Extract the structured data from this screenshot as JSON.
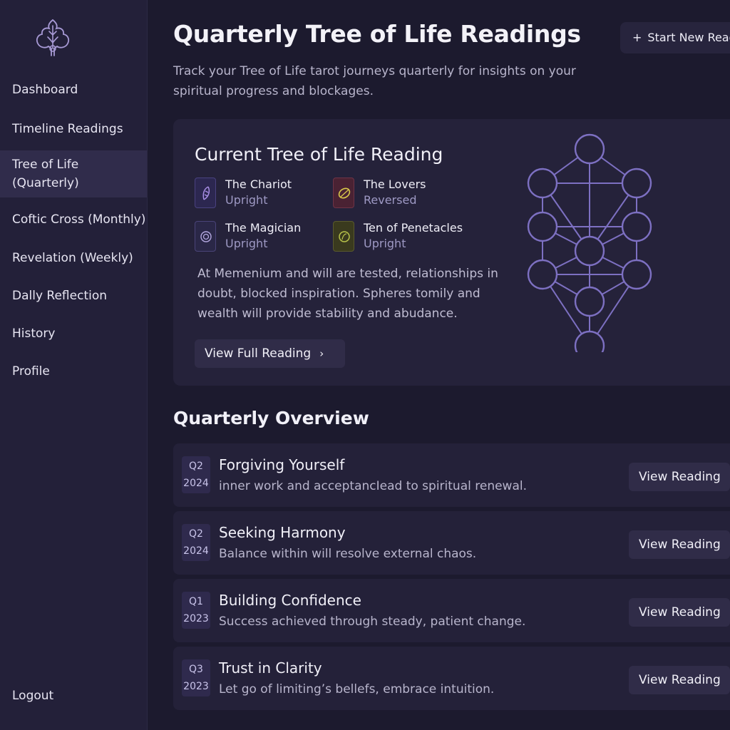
{
  "sidebar": {
    "items": [
      {
        "label": "Dashboard",
        "active": false
      },
      {
        "label": "Timeline Readings",
        "active": false
      },
      {
        "label": "Tree of Life (Quarterly)",
        "active": true
      },
      {
        "label": "Coftic Cross (Monthly)",
        "active": false
      },
      {
        "label": "Revelation (Weekly)",
        "active": false
      },
      {
        "label": "Dally Reflection",
        "active": false
      },
      {
        "label": "History",
        "active": false
      },
      {
        "label": "Profile",
        "active": false
      }
    ],
    "logout": "Logout",
    "logo_icon": "tree-of-life-logo-icon"
  },
  "header": {
    "title": "Quarterly Tree of Life Readings",
    "subtitle": "Track your Tree of Life tarot journeys quarterly for insights on your spiritual progress and blockages.",
    "start_button": "Start New Reading",
    "start_icon": "plus"
  },
  "current": {
    "title": "Current Tree of Life Reading",
    "cards": [
      {
        "name": "The Chariot",
        "orientation": "Upright",
        "icon": "feather-icon",
        "color": "#a98fe6"
      },
      {
        "name": "The Lovers",
        "orientation": "Reversed",
        "icon": "leaf-icon",
        "color": "#d9c84a"
      },
      {
        "name": "The Magician",
        "orientation": "Upright",
        "icon": "spiral-icon",
        "color": "#a98fe6"
      },
      {
        "name": "Ten of Penetacles",
        "orientation": "Upright",
        "icon": "coin-icon",
        "color": "#b7c24a"
      }
    ],
    "summary": "At Memenium and will are tested, relationships in doubt, blocked inspiration. Spheres tomily and wealth will provide stability and abudance.",
    "button": "View Full Reading",
    "diagram_icon": "sephirot-tree-diagram"
  },
  "overview": {
    "title": "Quarterly Overview",
    "rows": [
      {
        "quarter": "Q2",
        "year": "2024",
        "title": "Forgiving Yourself",
        "desc": "inner work and acceptancIead to spiritual renewal.",
        "button": "View Reading"
      },
      {
        "quarter": "Q2",
        "year": "2024",
        "title": "Seeking Harmony",
        "desc": "Balance within will resolve external chaos.",
        "button": "View Reading"
      },
      {
        "quarter": "Q1",
        "year": "2023",
        "title": "Building Confidence",
        "desc": "Success achieved through steady, patient change.",
        "button": "View Reading"
      },
      {
        "quarter": "Q3",
        "year": "2023",
        "title": "Trust in Clarity",
        "desc": "Let go of limiting’s bellefs, embrace intuition.",
        "button": "View Reading"
      }
    ]
  },
  "colors": {
    "background": "#1c1a2e",
    "sidebar": "#232039",
    "accent": "#8a7cd0"
  }
}
